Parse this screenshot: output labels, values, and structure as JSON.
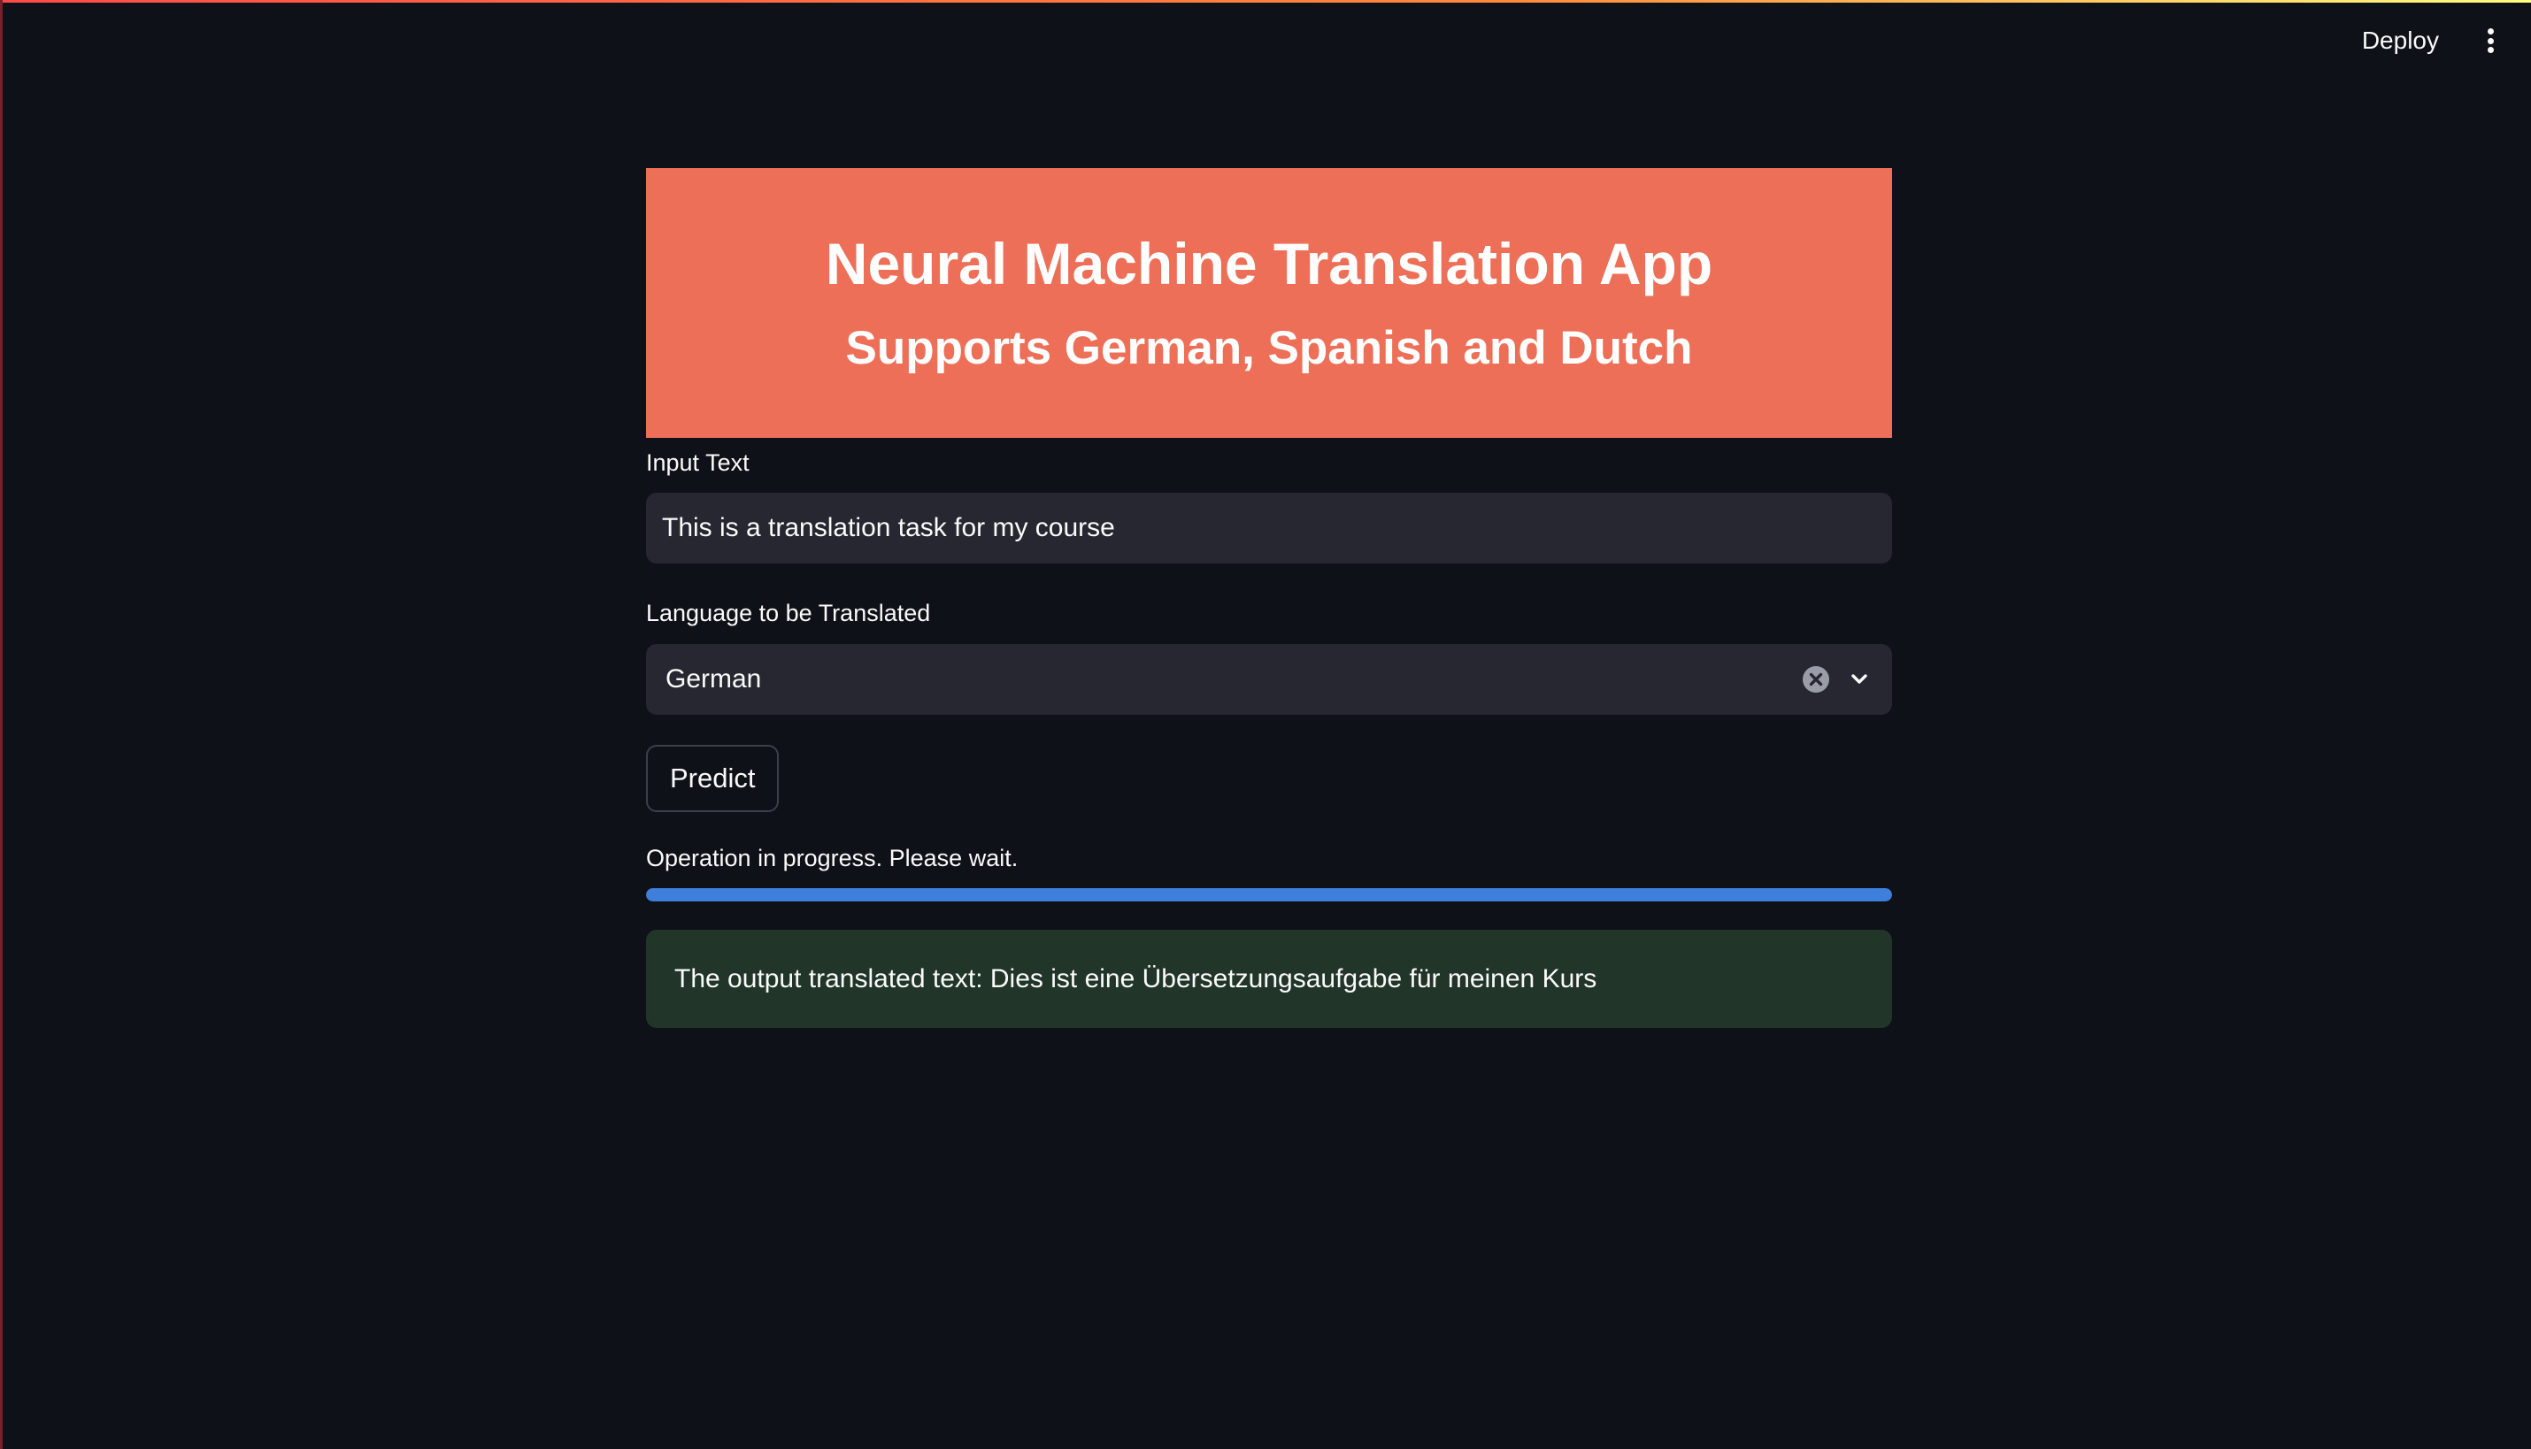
{
  "header": {
    "deploy_label": "Deploy",
    "menu_icon": "vertical-ellipsis-icon"
  },
  "banner": {
    "title": "Neural Machine Translation App",
    "subtitle": "Supports German, Spanish and Dutch",
    "background_color": "#ee6f57"
  },
  "form": {
    "input_label": "Input Text",
    "input_value": "This is a translation task for my course",
    "language_label": "Language to be Translated",
    "language_selected": "German",
    "clear_icon": "clear-circle-icon",
    "dropdown_icon": "chevron-down-icon",
    "predict_label": "Predict"
  },
  "progress": {
    "text": "Operation in progress. Please wait.",
    "value": 1.0,
    "color": "#3d7fdb"
  },
  "result": {
    "text": "The output translated text: Dies ist eine Übersetzungsaufgabe für meinen Kurs",
    "background_color": "#213529"
  }
}
